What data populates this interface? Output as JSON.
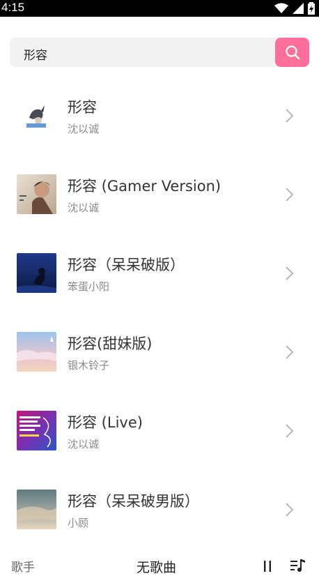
{
  "status": {
    "time": "4:15"
  },
  "search": {
    "query": "形容"
  },
  "results": [
    {
      "title": "形容",
      "artist": "沈以诚"
    },
    {
      "title": "形容 (Gamer Version)",
      "artist": "沈以诚"
    },
    {
      "title": "形容（呆呆破版）",
      "artist": "笨蛋小阳"
    },
    {
      "title": "形容(甜妹版)",
      "artist": "银木铃子"
    },
    {
      "title": "形容 (Live)",
      "artist": "沈以诚"
    },
    {
      "title": "形容（呆呆破男版）",
      "artist": "小顾"
    }
  ],
  "player": {
    "singer": "歌手",
    "song": "无歌曲"
  },
  "colors": {
    "accent": "#ff6f9c",
    "search_bg": "#f2f2f2",
    "subtitle": "#8a8a8a"
  },
  "icons": [
    "wifi-icon",
    "signal-icon",
    "battery-icon",
    "search-icon",
    "chevron-right-icon",
    "pause-icon",
    "playlist-icon"
  ]
}
